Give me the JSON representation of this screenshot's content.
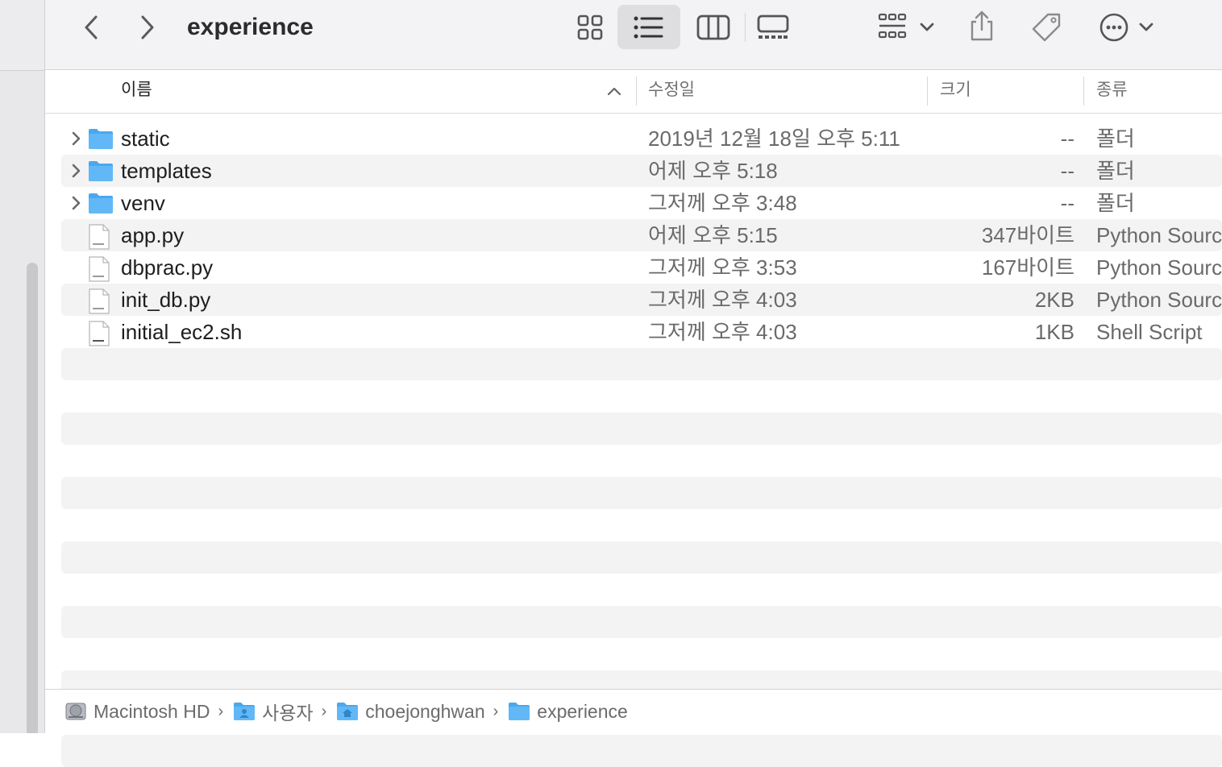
{
  "window": {
    "title": "experience"
  },
  "toolbar": {
    "icons": [
      "back-icon",
      "forward-icon",
      "icon-view-icon",
      "list-view-icon",
      "column-view-icon",
      "gallery-view-icon",
      "group-icon",
      "chevron-down-icon",
      "share-icon",
      "tag-icon",
      "more-icon",
      "chevron-down-icon"
    ],
    "selected_view": "list"
  },
  "columns": {
    "name": "이름",
    "date": "수정일",
    "size": "크기",
    "kind": "종류",
    "sort_column": "name",
    "sort_direction": "ascending"
  },
  "files": [
    {
      "name": "static",
      "date": "2019년 12월 18일 오후 5:11",
      "size": "--",
      "kind": "폴더",
      "type": "folder"
    },
    {
      "name": "templates",
      "date": "어제 오후 5:18",
      "size": "--",
      "kind": "폴더",
      "type": "folder"
    },
    {
      "name": "venv",
      "date": "그저께 오후 3:48",
      "size": "--",
      "kind": "폴더",
      "type": "folder"
    },
    {
      "name": "app.py",
      "date": "어제 오후 5:15",
      "size": "347바이트",
      "kind": "Python Source",
      "type": "python"
    },
    {
      "name": "dbprac.py",
      "date": "그저께 오후 3:53",
      "size": "167바이트",
      "kind": "Python Source",
      "type": "python"
    },
    {
      "name": "init_db.py",
      "date": "그저께 오후 4:03",
      "size": "2KB",
      "kind": "Python Source",
      "type": "python"
    },
    {
      "name": "initial_ec2.sh",
      "date": "그저께 오후 4:03",
      "size": "1KB",
      "kind": "Shell Script",
      "type": "shell"
    }
  ],
  "pathbar": {
    "crumbs": [
      "Macintosh HD",
      "사용자",
      "choejonghwan",
      "experience"
    ]
  },
  "colors": {
    "folder": "#5ab2f2",
    "toolbar_bg": "#f3f3f5",
    "row_alt": "#f3f3f4"
  }
}
